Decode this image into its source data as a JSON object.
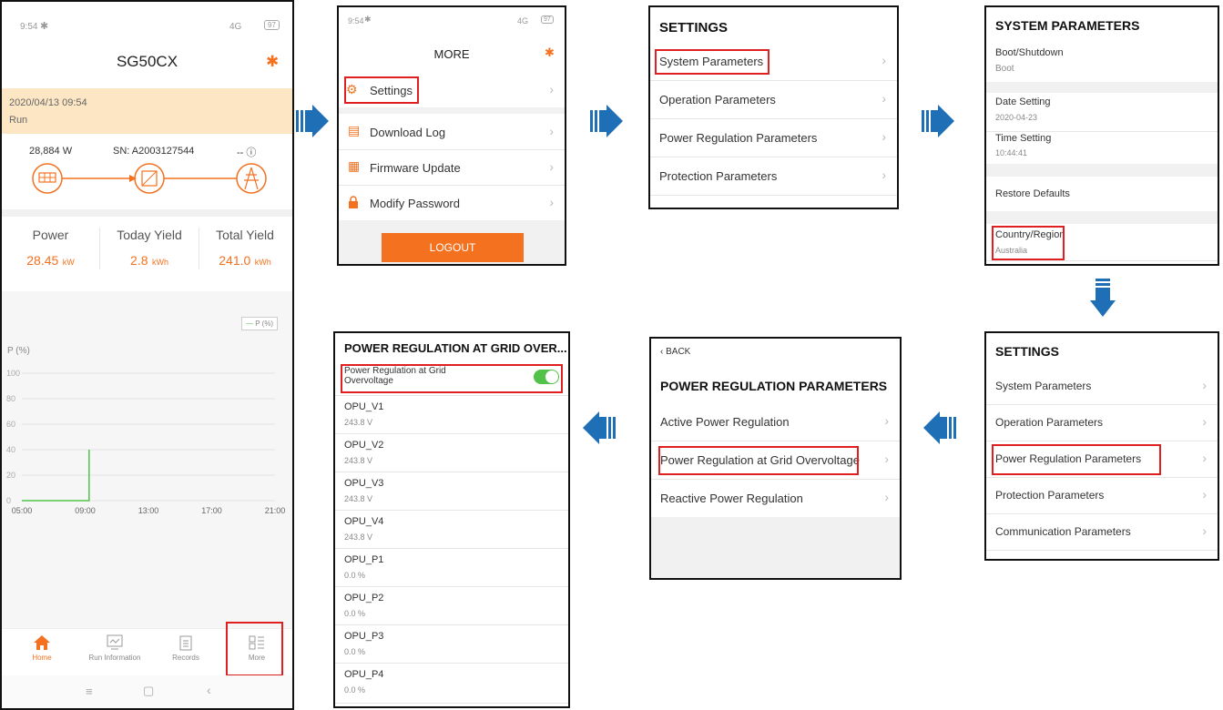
{
  "colors": {
    "orange": "#f4711f",
    "blue": "#1e6fb5",
    "red": "#e02020",
    "green": "#52c24a"
  },
  "home": {
    "status_time": "9:54",
    "status_signal": "4G",
    "status_battery": "97",
    "device": "SG50CX",
    "datetime": "2020/04/13 09:54",
    "state": "Run",
    "power_now": "28,884  W",
    "sn": "SN: A2003127544",
    "right_val": "-- ⓘ",
    "metrics": [
      {
        "label": "Power",
        "value": "28.45",
        "unit": "kW"
      },
      {
        "label": "Today Yield",
        "value": "2.8",
        "unit": "kWh"
      },
      {
        "label": "Total Yield",
        "value": "241.0",
        "unit": "kWh"
      }
    ],
    "legend": "P (%)",
    "y_title": "P (%)",
    "chart_data": {
      "type": "line",
      "x_ticks": [
        "05:00",
        "09:00",
        "13:00",
        "17:00",
        "21:00"
      ],
      "y_ticks": [
        "100",
        "80",
        "60",
        "40",
        "20",
        "0"
      ],
      "ylim": [
        0,
        100
      ],
      "series": [
        {
          "name": "P (%)",
          "x": [
            "05:00",
            "09:00",
            "09:15",
            "09:15"
          ],
          "y": [
            0,
            0,
            0,
            40
          ]
        }
      ]
    },
    "tabs": [
      "Home",
      "Run Information",
      "Records",
      "More"
    ]
  },
  "more": {
    "status_time": "9:54",
    "status_signal": "4G",
    "status_battery": "97",
    "title": "MORE",
    "items": [
      "Settings",
      "Download Log",
      "Firmware Update",
      "Modify Password"
    ],
    "logout": "LOGOUT"
  },
  "settings1": {
    "title": "SETTINGS",
    "items": [
      "System Parameters",
      "Operation Parameters",
      "Power Regulation Parameters",
      "Protection Parameters"
    ]
  },
  "sysparams": {
    "title": "SYSTEM PARAMETERS",
    "items": [
      {
        "label": "Boot/Shutdown",
        "value": "Boot"
      },
      {
        "label": "Date Setting",
        "value": "2020-04-23"
      },
      {
        "label": "Time Setting",
        "value": "10:44:41"
      },
      {
        "label": "Restore Defaults",
        "value": ""
      },
      {
        "label": "Country/Region",
        "value": "Australia"
      }
    ]
  },
  "settings2": {
    "title": "SETTINGS",
    "items": [
      "System Parameters",
      "Operation Parameters",
      "Power Regulation Parameters",
      "Protection Parameters",
      "Communication Parameters"
    ]
  },
  "powerreg": {
    "back": "BACK",
    "title": "POWER REGULATION PARAMETERS",
    "items": [
      "Active Power Regulation",
      "Power Regulation at Grid Overvoltage",
      "Reactive Power Regulation"
    ]
  },
  "overvoltage": {
    "title": "POWER REGULATION AT GRID OVER...",
    "toggle_label": "Power Regulation at Grid Overvoltage",
    "toggle_on": true,
    "items": [
      {
        "label": "OPU_V1",
        "value": "243.8 V"
      },
      {
        "label": "OPU_V2",
        "value": "243.8 V"
      },
      {
        "label": "OPU_V3",
        "value": "243.8 V"
      },
      {
        "label": "OPU_V4",
        "value": "243.8 V"
      },
      {
        "label": "OPU_P1",
        "value": "0.0 %"
      },
      {
        "label": "OPU_P2",
        "value": "0.0 %"
      },
      {
        "label": "OPU_P3",
        "value": "0.0 %"
      },
      {
        "label": "OPU_P4",
        "value": "0.0 %"
      }
    ]
  }
}
